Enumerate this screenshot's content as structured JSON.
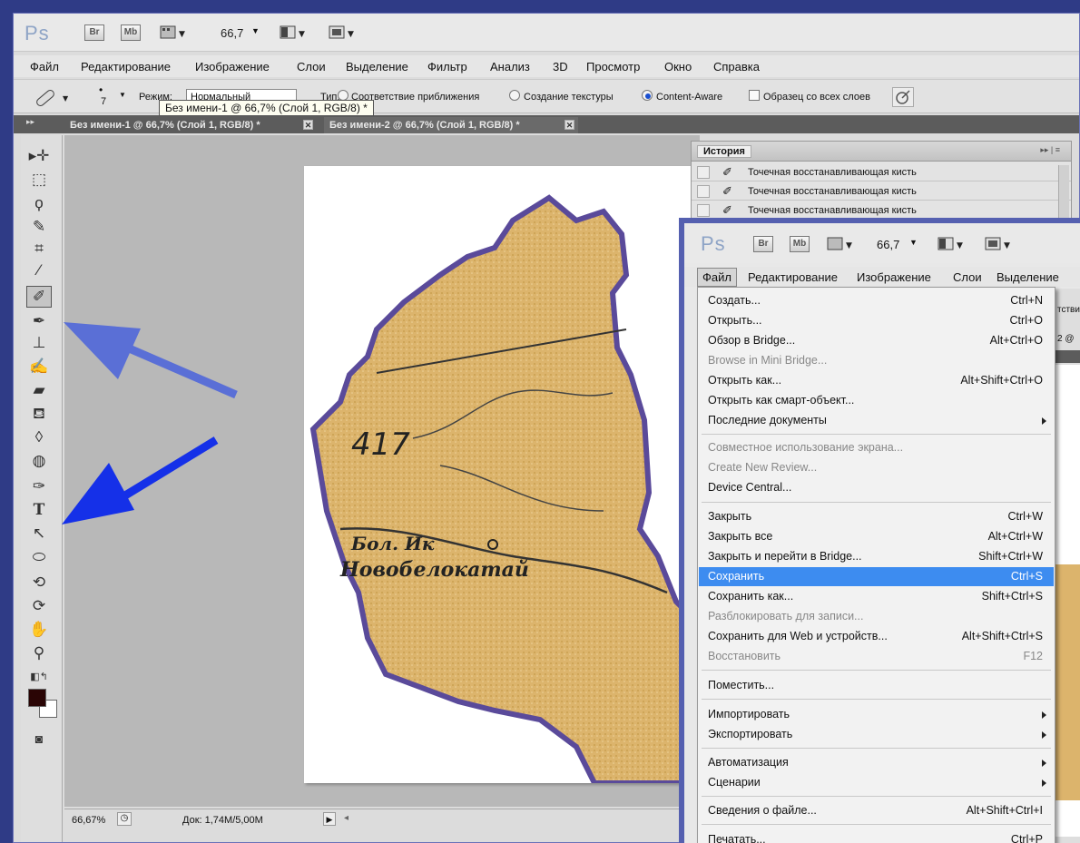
{
  "app": {
    "logo": "Ps",
    "bridge_btn": "Br",
    "minibridge_btn": "Mb",
    "zoom": "66,7"
  },
  "menubar": [
    "Файл",
    "Редактирование",
    "Изображение",
    "Слои",
    "Выделение",
    "Фильтр",
    "Анализ",
    "3D",
    "Просмотр",
    "Окно",
    "Справка"
  ],
  "options": {
    "brush_size": "7",
    "mode_label": "Режим:",
    "mode_value": "Нормальный",
    "type_label": "Тип:",
    "type_opt1": "Соответствие приближения",
    "type_opt2": "Создание текстуры",
    "type_opt3": "Content-Aware",
    "sample_all": "Образец со всех слоев"
  },
  "tooltip": "Без имени-1 @ 66,7% (Слой 1, RGB/8) *",
  "tabs": [
    "Без имени-1 @ 66,7% (Слой 1, RGB/8) *",
    "Без имени-2 @ 66,7% (Слой 1, RGB/8) *"
  ],
  "history": {
    "title": "История",
    "rows": [
      "Точечная восстанавливающая кисть",
      "Точечная восстанавливающая кисть",
      "Точечная восстанавливающая кисть"
    ]
  },
  "map": {
    "number": "417",
    "river_label": "Бол. Ик",
    "village_label": "Новобелокатай"
  },
  "status": {
    "zoom": "66,67%",
    "doc": "Док: 1,74M/5,00M"
  },
  "second_window": {
    "logo": "Ps",
    "bridge_btn": "Br",
    "minibridge_btn": "Mb",
    "zoom": "66,7",
    "menubar": [
      "Файл",
      "Редактирование",
      "Изображение",
      "Слои",
      "Выделение"
    ],
    "behind_texts": [
      "тстви",
      "2 @ "
    ],
    "file_menu": [
      {
        "label": "Создать...",
        "shortcut": "Ctrl+N"
      },
      {
        "label": "Открыть...",
        "shortcut": "Ctrl+O"
      },
      {
        "label": "Обзор в Bridge...",
        "shortcut": "Alt+Ctrl+O"
      },
      {
        "label": "Browse in Mini Bridge...",
        "shortcut": ""
      },
      {
        "label": "Открыть как...",
        "shortcut": "Alt+Shift+Ctrl+O"
      },
      {
        "label": "Открыть как смарт-объект...",
        "shortcut": ""
      },
      {
        "label": "Последние документы",
        "shortcut": ""
      },
      {
        "label": "Совместное использование экрана...",
        "shortcut": ""
      },
      {
        "label": "Create New Review...",
        "shortcut": ""
      },
      {
        "label": "Device Central...",
        "shortcut": ""
      },
      {
        "label": "Закрыть",
        "shortcut": "Ctrl+W"
      },
      {
        "label": "Закрыть все",
        "shortcut": "Alt+Ctrl+W"
      },
      {
        "label": "Закрыть и перейти в Bridge...",
        "shortcut": "Shift+Ctrl+W"
      },
      {
        "label": "Сохранить",
        "shortcut": "Ctrl+S"
      },
      {
        "label": "Сохранить как...",
        "shortcut": "Shift+Ctrl+S"
      },
      {
        "label": "Разблокировать для записи...",
        "shortcut": ""
      },
      {
        "label": "Сохранить для Web и устройств...",
        "shortcut": "Alt+Shift+Ctrl+S"
      },
      {
        "label": "Восстановить",
        "shortcut": "F12"
      },
      {
        "label": "Поместить...",
        "shortcut": ""
      },
      {
        "label": "Импортировать",
        "shortcut": ""
      },
      {
        "label": "Экспортировать",
        "shortcut": ""
      },
      {
        "label": "Автоматизация",
        "shortcut": ""
      },
      {
        "label": "Сценарии",
        "shortcut": ""
      },
      {
        "label": "Сведения о файле...",
        "shortcut": "Alt+Shift+Ctrl+I"
      },
      {
        "label": "Печатать...",
        "shortcut": "Ctrl+P"
      }
    ]
  },
  "colors": {
    "background": "#2f3b86",
    "highlight": "#3d8cf0",
    "arrow": "#4f67d8",
    "map_fill": "#dcb46c",
    "map_border": "#5a4a9a"
  }
}
